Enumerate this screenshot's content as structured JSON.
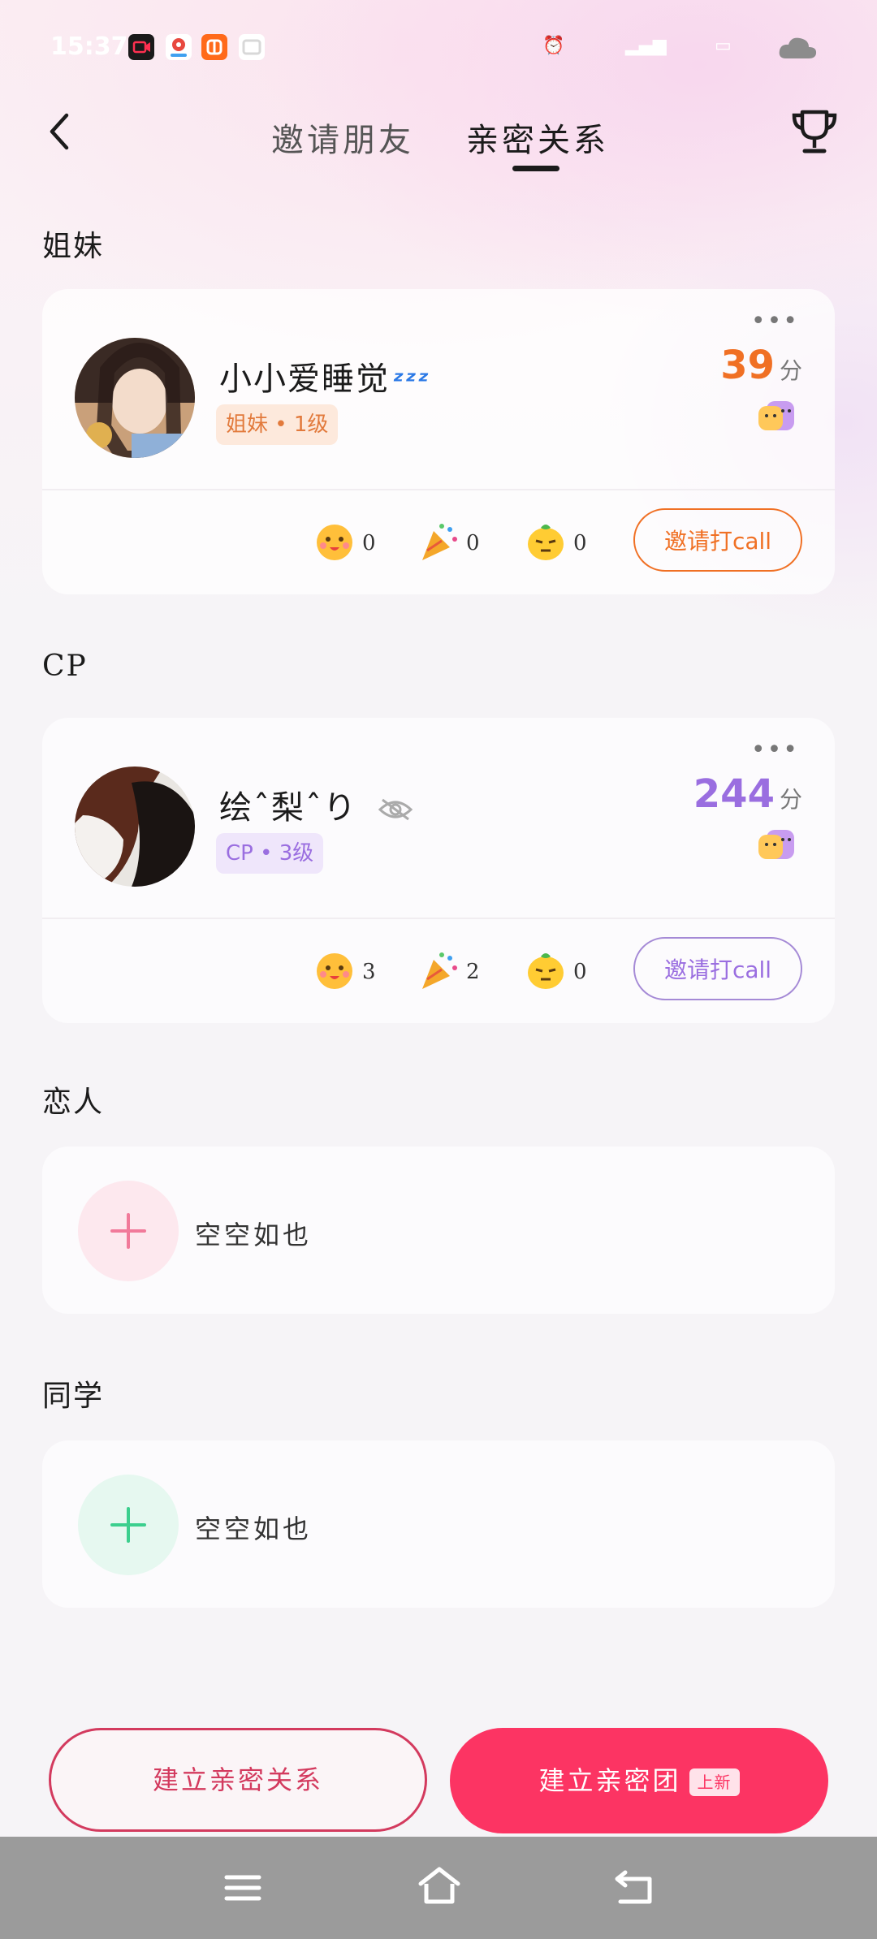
{
  "status_bar": {
    "time": "15:37"
  },
  "header": {
    "tabs": [
      {
        "label": "邀请朋友"
      },
      {
        "label": "亲密关系"
      }
    ],
    "active_tab": 1
  },
  "sections": {
    "sisters": {
      "title": "姐妹",
      "friend": {
        "name": "小小爱睡觉",
        "badge": "姐妹 • 1级",
        "score": "39",
        "score_unit": "分",
        "reactions": [
          "0",
          "0",
          "0"
        ],
        "call_label": "邀请打call"
      }
    },
    "cp": {
      "title": "CP",
      "friend": {
        "name": "绘ˆ梨ˆり",
        "badge": "CP • 3级",
        "score": "244",
        "score_unit": "分",
        "reactions": [
          "3",
          "2",
          "0"
        ],
        "call_label": "邀请打call"
      }
    },
    "lovers": {
      "title": "恋人",
      "empty_text": "空空如也"
    },
    "classmates": {
      "title": "同学",
      "empty_text": "空空如也"
    }
  },
  "footer": {
    "build_relation": "建立亲密关系",
    "build_group": "建立亲密团",
    "new_tag": "上新"
  },
  "colors": {
    "orange": "#f07024",
    "purple": "#9a6ee0",
    "pink": "#fc3463",
    "green": "#3ccf8e"
  }
}
